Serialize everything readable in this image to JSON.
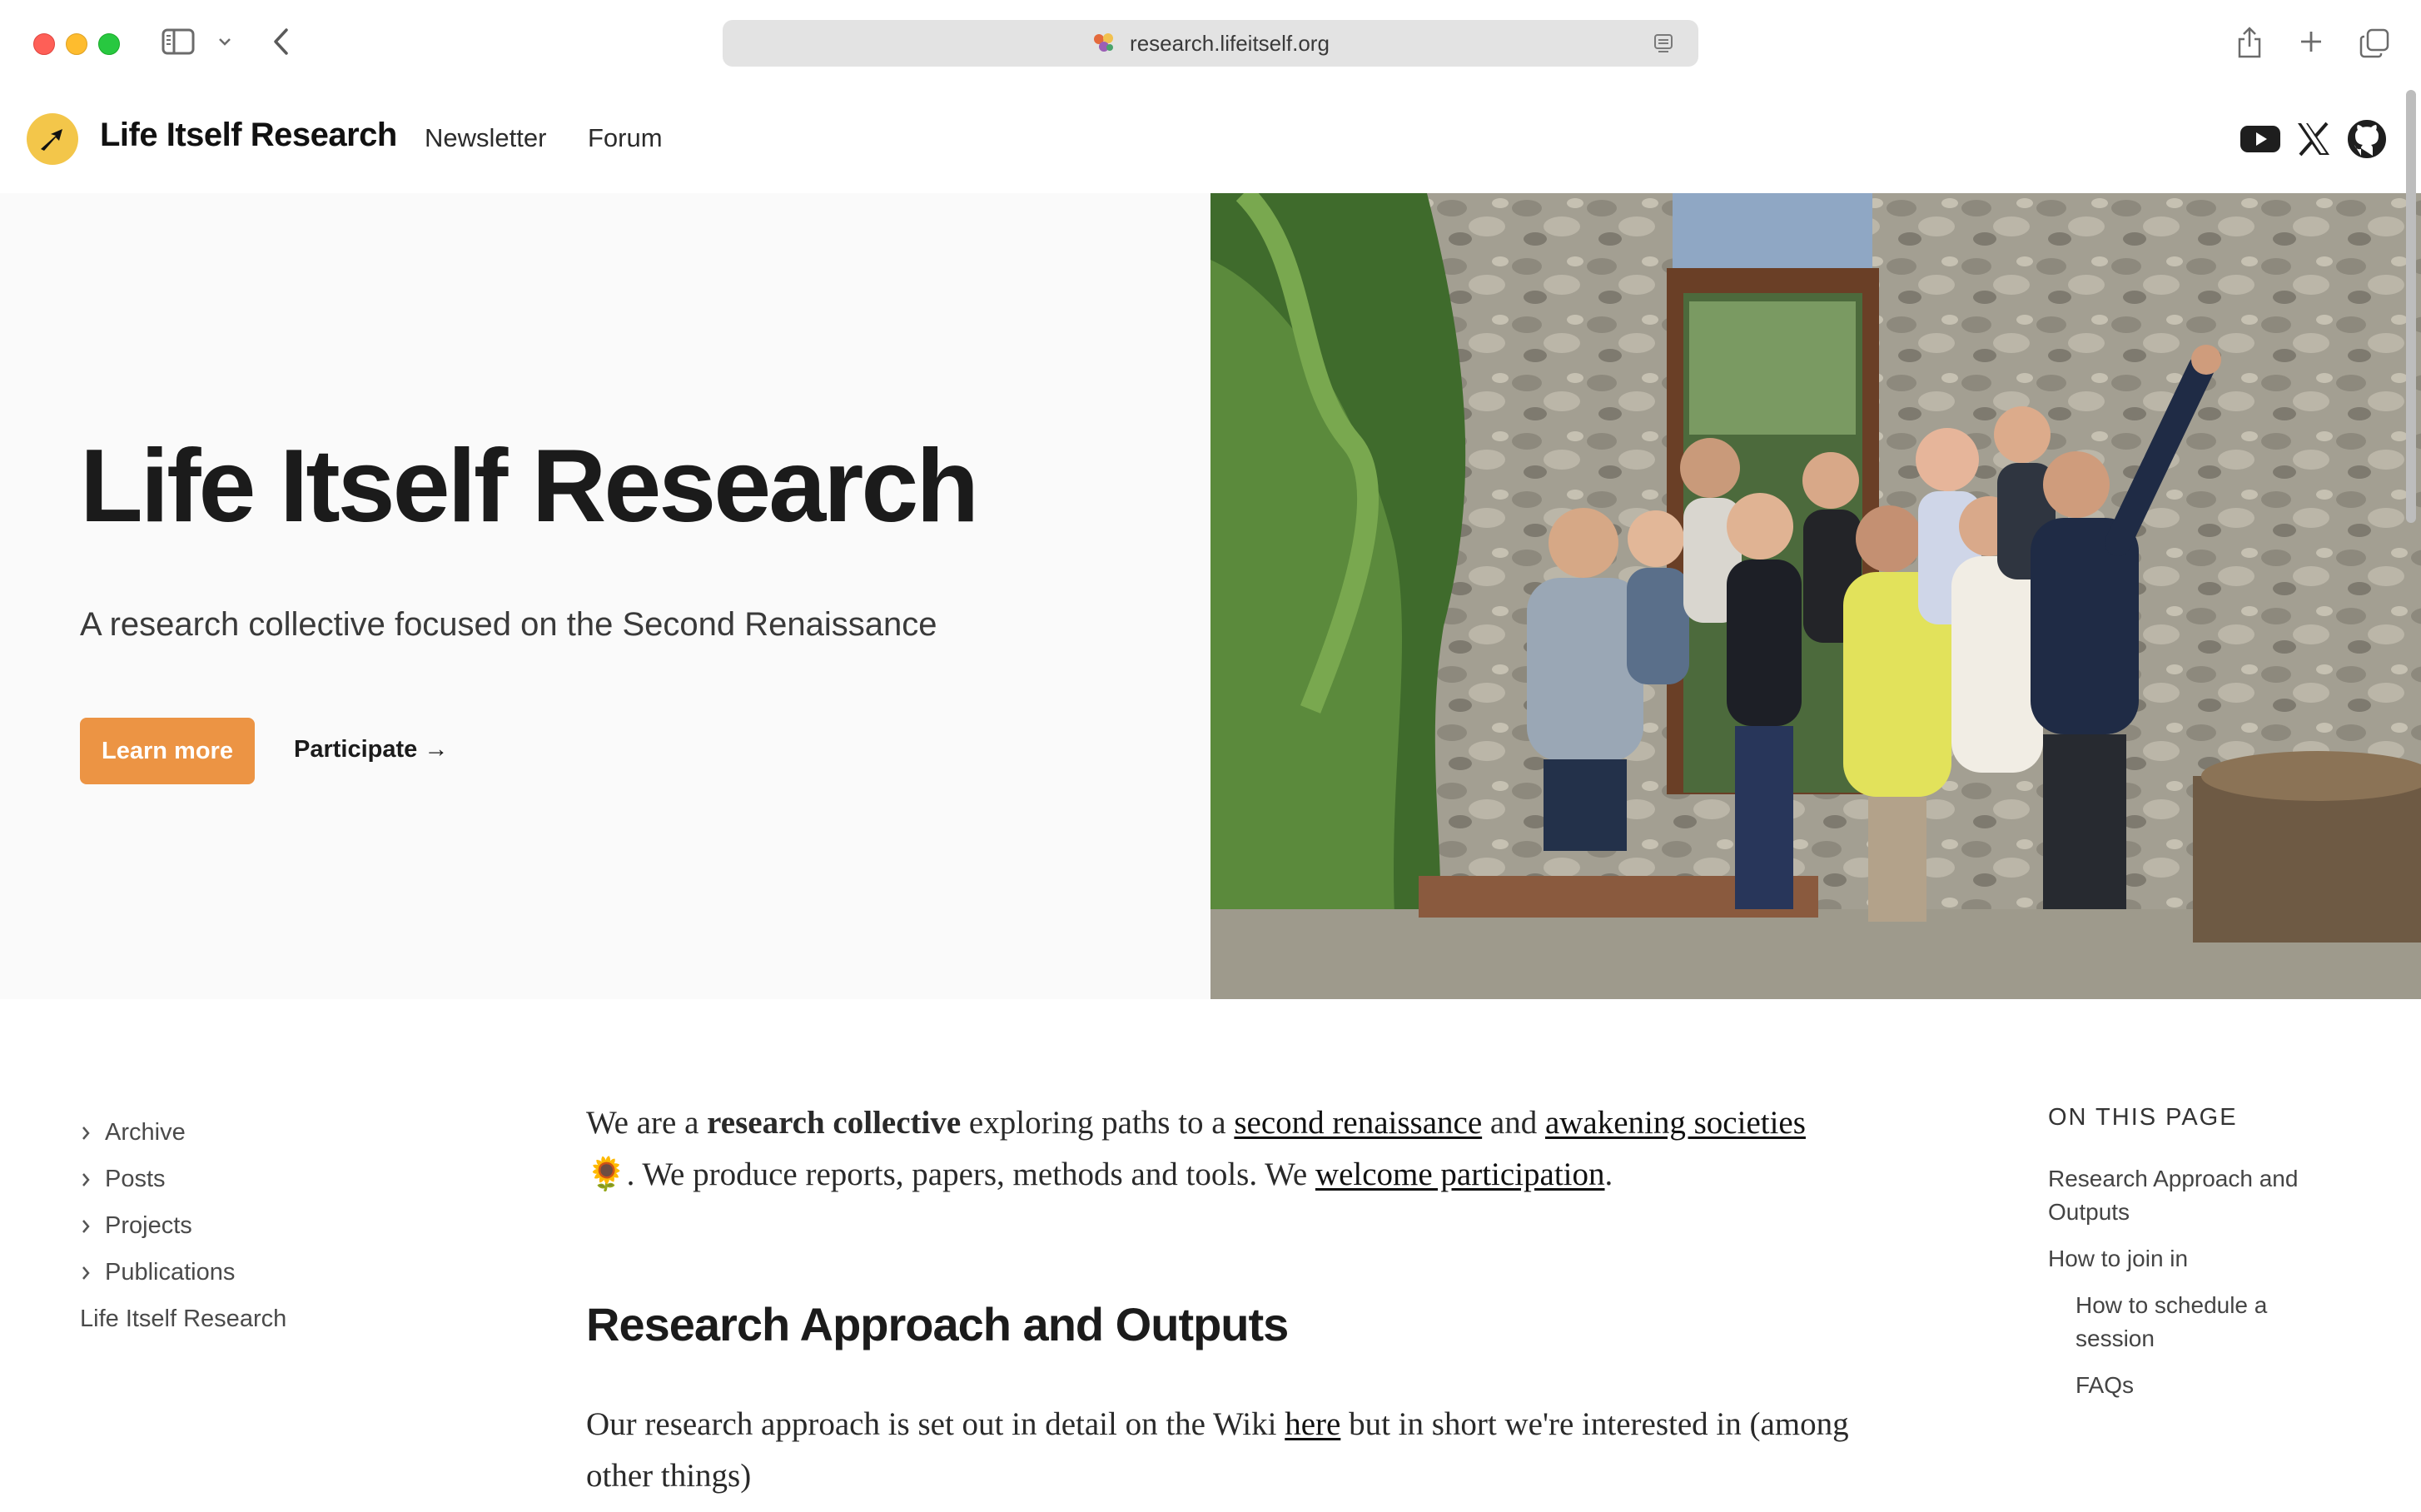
{
  "browser": {
    "url": "research.lifeitself.org"
  },
  "header": {
    "site_title": "Life Itself Research",
    "nav": [
      "Newsletter",
      "Forum"
    ],
    "social_icons": [
      "youtube-icon",
      "x-icon",
      "github-icon"
    ]
  },
  "hero": {
    "title": "Life Itself Research",
    "subtitle": "A research collective focused on the Second Renaissance",
    "primary_button": "Learn more",
    "secondary_link": "Participate →",
    "accent_color": "#ec9444"
  },
  "sidebar": {
    "items": [
      "Archive",
      "Posts",
      "Projects",
      "Publications"
    ],
    "home": "Life Itself Research"
  },
  "article": {
    "intro": {
      "t1": "We are a ",
      "bold": "research collective",
      "t2": " exploring paths to a ",
      "link1": "second renaissance",
      "t3": " and ",
      "link2": "awakening societies",
      "emoji": "🌻",
      "t4": ". We produce reports, papers, methods and tools. We ",
      "link3": "welcome participation",
      "t5": "."
    },
    "heading": "Research Approach and Outputs",
    "approach": {
      "t1": "Our research approach is set out in detail on the Wiki ",
      "link": "here",
      "t2": " but in short we're interested in (among other things)"
    }
  },
  "toc": {
    "heading": "ON THIS PAGE",
    "items": [
      "Research Approach and Outputs",
      "How to join in",
      "How to schedule a session",
      "FAQs"
    ]
  }
}
